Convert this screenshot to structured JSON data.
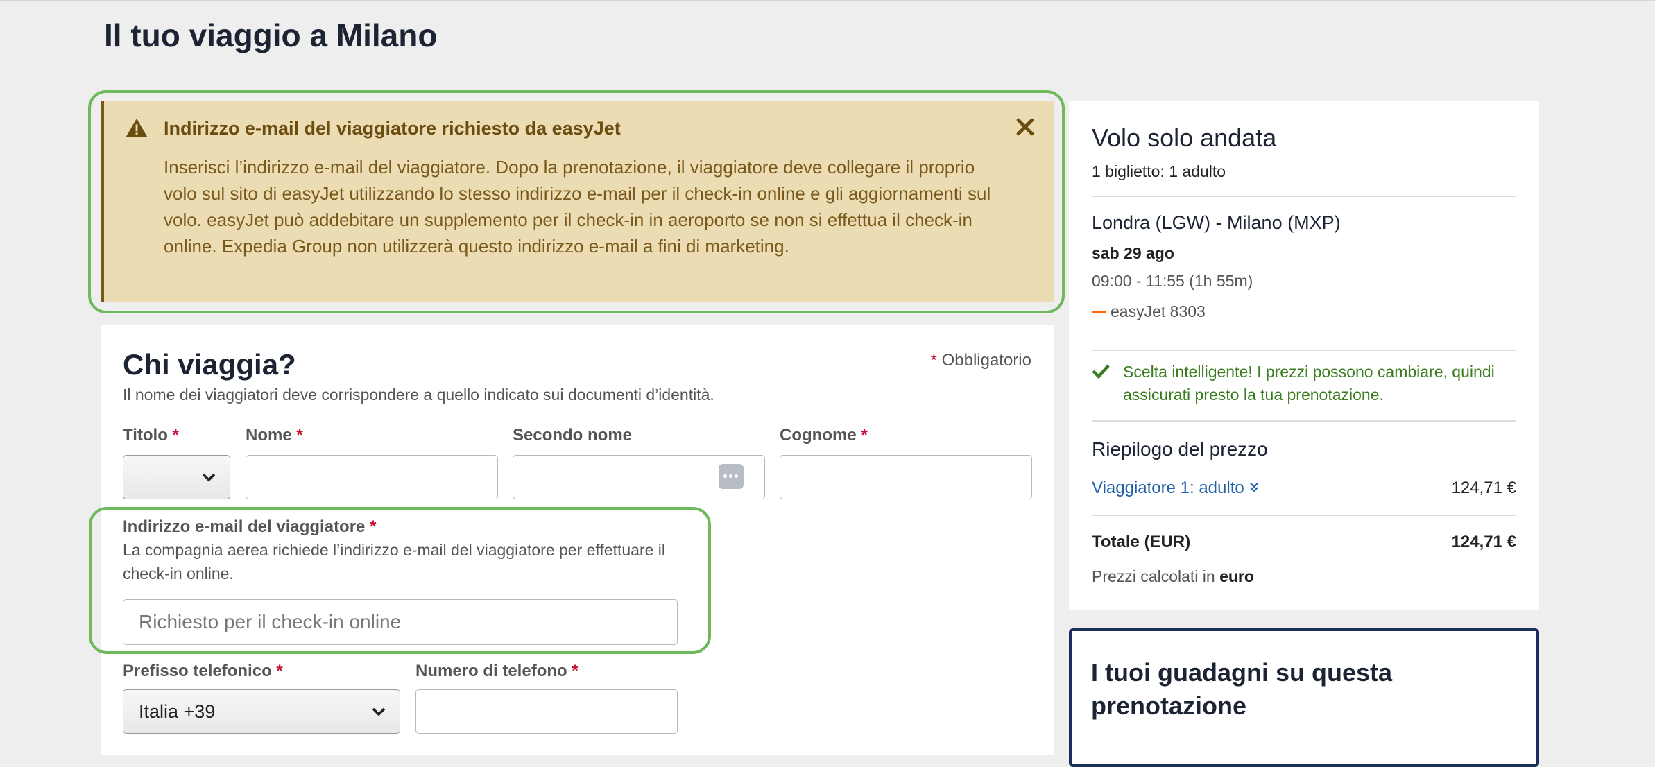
{
  "page": {
    "title": "Il tuo viaggio a Milano"
  },
  "alert": {
    "title": "Indirizzo e-mail del viaggiatore richiesto da easyJet",
    "body": "Inserisci l’indirizzo e-mail del viaggiatore. Dopo la prenotazione, il viaggiatore deve collegare il proprio volo sul sito di easyJet utilizzando lo stesso indirizzo e-mail per il check-in online e gli aggiornamenti sul volo. easyJet può addebitare un supplemento per il check-in in aeroporto se non si effettua il check-in online. Expedia Group non utilizzerà questo indirizzo e-mail a fini di marketing.",
    "icon": "warning-icon",
    "close_icon": "close-icon"
  },
  "form": {
    "heading": "Chi viaggia?",
    "required_note": "Obbligatorio",
    "subtitle": "Il nome dei viaggiatori deve corrispondere a quello indicato sui documenti d’identità.",
    "title_label": "Titolo",
    "first_name_label": "Nome",
    "middle_name_label": "Secondo nome",
    "last_name_label": "Cognome",
    "email_label": "Indirizzo e-mail del viaggiatore",
    "email_hint": "La compagnia aerea richiede l’indirizzo e-mail del viaggiatore per effettuare il check-in online.",
    "email_placeholder": "Richiesto per il check-in online",
    "phone_prefix_label": "Prefisso telefonico",
    "phone_prefix_value": "Italia +39",
    "phone_label": "Numero di telefono"
  },
  "summary": {
    "title": "Volo solo andata",
    "tickets": "1 biglietto: 1 adulto",
    "route": "Londra (LGW) - Milano (MXP)",
    "date": "sab 29 ago",
    "time": "09:00 - 11:55 (1h 55m)",
    "airline": "easyJet 8303",
    "smart_choice": "Scelta intelligente! I prezzi possono cambiare, quindi assicurati presto la tua prenotazione.",
    "price_heading": "Riepilogo del prezzo",
    "traveler_label": "Viaggiatore 1: adulto",
    "traveler_price": "124,71 €",
    "total_label": "Totale (EUR)",
    "total_value": "124,71 €",
    "calc_prefix": "Prezzi calcolati in",
    "calc_currency": "euro"
  },
  "earnings": {
    "title": "I tuoi guadagni su questa prenotazione"
  },
  "colors": {
    "highlight": "#6fb85c",
    "alert_bg": "#ecdcb4",
    "link": "#2160a8",
    "success": "#3a7d1e",
    "required": "#c8102e"
  }
}
